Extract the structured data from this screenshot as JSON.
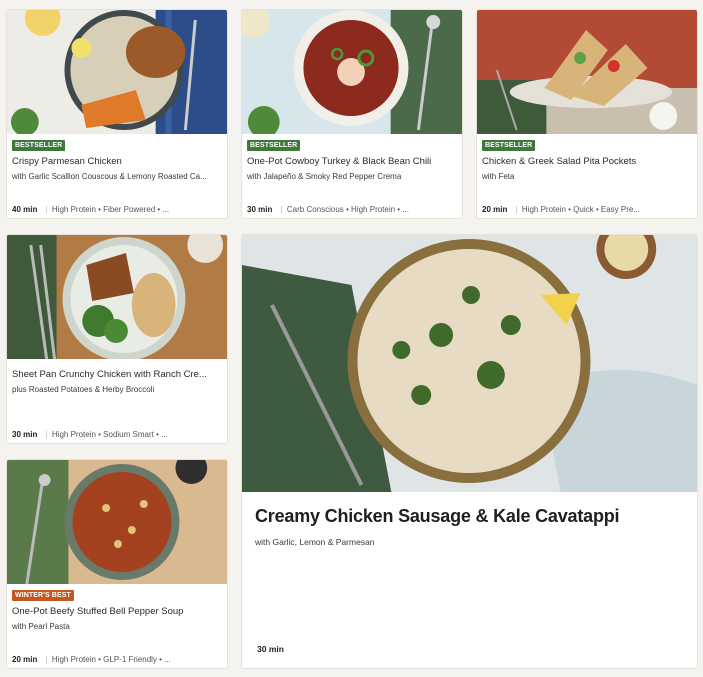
{
  "colors": {
    "bestseller_badge": "#3b7a3b",
    "winters_best_badge": "#c4571f"
  },
  "cards": [
    {
      "badge": "BESTSELLER",
      "title": "Crispy Parmesan Chicken",
      "subtitle": "with Garlic Scallion Couscous & Lemony Roasted Ca...",
      "time": "40 min",
      "tags": "High Protein • Fiber Powered • ..."
    },
    {
      "badge": "BESTSELLER",
      "title": "One-Pot Cowboy Turkey & Black Bean Chili",
      "subtitle": "with Jalapeño & Smoky Red Pepper Crema",
      "time": "30 min",
      "tags": "Carb Conscious • High Protein • ..."
    },
    {
      "badge": "BESTSELLER",
      "title": "Chicken & Greek Salad Pita Pockets",
      "subtitle": "with Feta",
      "time": "20 min",
      "tags": "High Protein • Quick • Easy Pre..."
    },
    {
      "badge": "",
      "title": "Sheet Pan Crunchy Chicken with Ranch Cre...",
      "subtitle": "plus Roasted Potatoes & Herby Broccoli",
      "time": "30 min",
      "tags": "High Protein • Sodium Smart • ..."
    },
    {
      "badge": "WINTER'S BEST",
      "title": "One-Pot Beefy Stuffed Bell Pepper Soup",
      "subtitle": "with Pearl Pasta",
      "time": "20 min",
      "tags": "High Protein • GLP-1 Friendly • ..."
    }
  ],
  "featured": {
    "title": "Creamy Chicken Sausage & Kale Cavatappi",
    "subtitle": "with Garlic, Lemon & Parmesan",
    "time": "30 min"
  }
}
